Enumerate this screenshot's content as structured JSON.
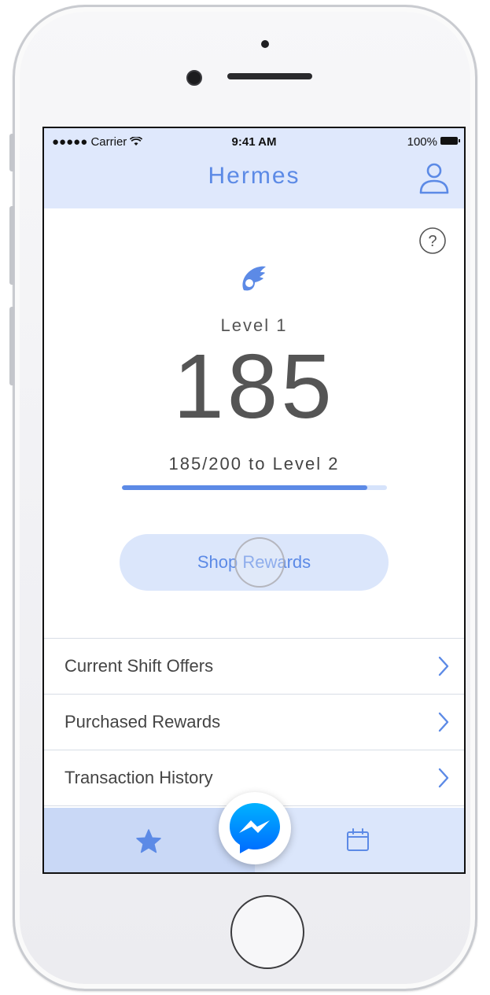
{
  "status_bar": {
    "carrier": "●●●●● Carrier",
    "time": "9:41 AM",
    "battery": "100%"
  },
  "header": {
    "title": "Hermes"
  },
  "rewards": {
    "level_label": "Level 1",
    "points": "185",
    "progress_text": "185/200 to Level 2",
    "progress_fraction": 0.925,
    "shop_button": "Shop Rewards"
  },
  "menu": [
    {
      "label": "Current Shift Offers"
    },
    {
      "label": "Purchased Rewards"
    },
    {
      "label": "Transaction History"
    }
  ],
  "icons": {
    "profile": "person-outline-icon",
    "help": "question-circle-icon",
    "level": "wing-icon",
    "tab_star": "star-icon",
    "tab_calendar": "calendar-icon",
    "messenger": "messenger-icon",
    "chevron": "chevron-right-icon"
  },
  "colors": {
    "accent": "#5c8ae6",
    "header_bg": "#dfe8fc",
    "button_bg": "#dbe6fb"
  }
}
